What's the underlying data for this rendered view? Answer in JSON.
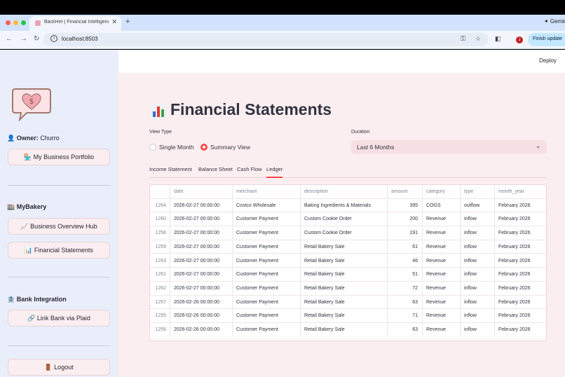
{
  "browser": {
    "tab_title": "BackHer | Financial Intelligence",
    "new_tab": "+",
    "close": "✕",
    "gemini": "✦ Gemini",
    "url": "localhost:8503",
    "finish_update": "Finish update",
    "profile_initial": "J",
    "traffic_colors": [
      "#ff5f57",
      "#febc2e",
      "#28c840"
    ]
  },
  "app_header": {
    "deploy": "Deploy"
  },
  "sidebar": {
    "owner_label": "👤 Owner:",
    "owner_name": "Churro",
    "portfolio_button": "🏪 My Business Portfolio",
    "section_bakery": "🏬 MyBakery",
    "overview_button": "📈 Business Overview Hub",
    "statements_button": "📊 Financial Statements",
    "section_bank": "🏦 Bank Integration",
    "plaid_button": "🔗 Link Bank via Plaid",
    "logout_button": "🚪 Logout"
  },
  "main": {
    "title": "Financial Statements",
    "view_type_label": "View Type",
    "view_options": [
      "Single Month",
      "Summary View"
    ],
    "view_selected": "Summary View",
    "duration_label": "Duration",
    "duration_value": "Last 6 Months",
    "tabs": [
      "Income Statement",
      "Balance Sheet",
      "Cash Flow",
      "Ledger"
    ],
    "active_tab": "Ledger",
    "accent": "#ff4b4b"
  },
  "ledger": {
    "columns": [
      "",
      "date",
      "merchant",
      "description",
      "amount",
      "category",
      "type",
      "month_year"
    ],
    "rows": [
      [
        "1264",
        "2026-02-27 00:00:00",
        "Costco Wholesale",
        "Baking Ingredients & Materials",
        "395",
        "COGS",
        "outflow",
        "February 2026"
      ],
      [
        "1260",
        "2026-02-27 00:00:00",
        "Customer Payment",
        "Custom Cookie Order",
        "200",
        "Revenue",
        "inflow",
        "February 2026"
      ],
      [
        "1258",
        "2026-02-27 00:00:00",
        "Customer Payment",
        "Custom Cookie Order",
        "191",
        "Revenue",
        "inflow",
        "February 2026"
      ],
      [
        "1259",
        "2026-02-27 00:00:00",
        "Customer Payment",
        "Retail Bakery Sale",
        "61",
        "Revenue",
        "inflow",
        "February 2026"
      ],
      [
        "1263",
        "2026-02-27 00:00:00",
        "Customer Payment",
        "Retail Bakery Sale",
        "46",
        "Revenue",
        "inflow",
        "February 2026"
      ],
      [
        "1261",
        "2026-02-27 00:00:00",
        "Customer Payment",
        "Retail Bakery Sale",
        "51",
        "Revenue",
        "inflow",
        "February 2026"
      ],
      [
        "1262",
        "2026-02-27 00:00:00",
        "Customer Payment",
        "Retail Bakery Sale",
        "72",
        "Revenue",
        "inflow",
        "February 2026"
      ],
      [
        "1257",
        "2026-02-26 00:00:00",
        "Customer Payment",
        "Retail Bakery Sale",
        "63",
        "Revenue",
        "inflow",
        "February 2026"
      ],
      [
        "1255",
        "2026-02-26 00:00:00",
        "Customer Payment",
        "Retail Bakery Sale",
        "71",
        "Revenue",
        "inflow",
        "February 2026"
      ],
      [
        "1256",
        "2026-02-26 00:00:00",
        "Customer Payment",
        "Retail Bakery Sale",
        "63",
        "Revenue",
        "inflow",
        "February 2026"
      ]
    ]
  }
}
